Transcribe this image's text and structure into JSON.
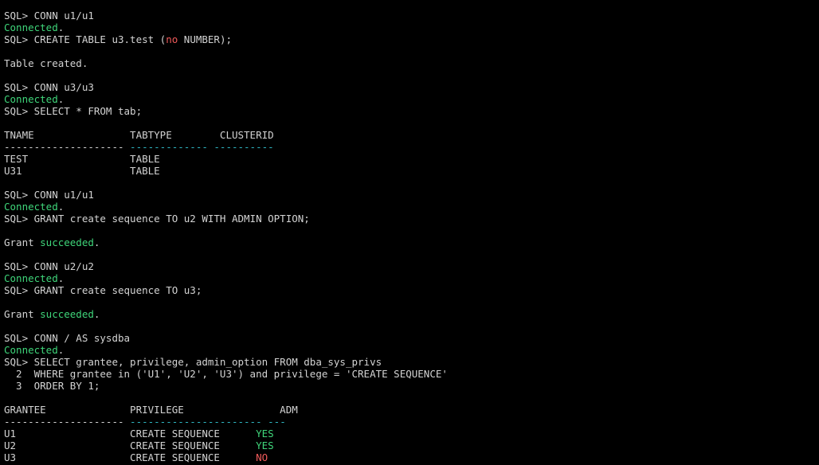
{
  "colors": {
    "background": "#000000",
    "text": "#d3d3d3",
    "green": "#3fd67a",
    "red": "#f05a5a",
    "teal": "#2fb6c2"
  },
  "terminal": {
    "lines": [
      {
        "segs": [
          {
            "t": "SQL> CONN u1/u1"
          }
        ]
      },
      {
        "segs": [
          {
            "t": "Connected",
            "c": "green"
          },
          {
            "t": "."
          }
        ]
      },
      {
        "segs": [
          {
            "t": "SQL> CREATE TABLE u3.test ("
          },
          {
            "t": "no",
            "c": "red"
          },
          {
            "t": " NUMBER);"
          }
        ]
      },
      {
        "segs": []
      },
      {
        "segs": [
          {
            "t": "Table created."
          }
        ]
      },
      {
        "segs": []
      },
      {
        "segs": [
          {
            "t": "SQL> CONN u3/u3"
          }
        ]
      },
      {
        "segs": [
          {
            "t": "Connected",
            "c": "green"
          },
          {
            "t": "."
          }
        ]
      },
      {
        "segs": [
          {
            "t": "SQL> SELECT * FROM tab;"
          }
        ]
      },
      {
        "segs": []
      },
      {
        "segs": [
          {
            "t": "TNAME                TABTYPE        CLUSTERID"
          }
        ]
      },
      {
        "segs": [
          {
            "t": "-------------------- "
          },
          {
            "t": "------------- ----------",
            "c": "teal"
          }
        ]
      },
      {
        "segs": [
          {
            "t": "TEST                 TABLE"
          }
        ]
      },
      {
        "segs": [
          {
            "t": "U31                  TABLE"
          }
        ]
      },
      {
        "segs": []
      },
      {
        "segs": [
          {
            "t": "SQL> CONN u1/u1"
          }
        ]
      },
      {
        "segs": [
          {
            "t": "Connected",
            "c": "green"
          },
          {
            "t": "."
          }
        ]
      },
      {
        "segs": [
          {
            "t": "SQL> GRANT create sequence TO u2 WITH ADMIN OPTION;"
          }
        ]
      },
      {
        "segs": []
      },
      {
        "segs": [
          {
            "t": "Grant "
          },
          {
            "t": "succeeded",
            "c": "green"
          },
          {
            "t": "."
          }
        ]
      },
      {
        "segs": []
      },
      {
        "segs": [
          {
            "t": "SQL> CONN u2/u2"
          }
        ]
      },
      {
        "segs": [
          {
            "t": "Connected",
            "c": "green"
          },
          {
            "t": "."
          }
        ]
      },
      {
        "segs": [
          {
            "t": "SQL> GRANT create sequence TO u3;"
          }
        ]
      },
      {
        "segs": []
      },
      {
        "segs": [
          {
            "t": "Grant "
          },
          {
            "t": "succeeded",
            "c": "green"
          },
          {
            "t": "."
          }
        ]
      },
      {
        "segs": []
      },
      {
        "segs": [
          {
            "t": "SQL> CONN / AS sysdba"
          }
        ]
      },
      {
        "segs": [
          {
            "t": "Connected",
            "c": "green"
          },
          {
            "t": "."
          }
        ]
      },
      {
        "segs": [
          {
            "t": "SQL> SELECT grantee, privilege, admin_option FROM dba_sys_privs"
          }
        ]
      },
      {
        "segs": [
          {
            "t": "  2  WHERE grantee in ('U1', 'U2', 'U3') and privilege = 'CREATE SEQUENCE'"
          }
        ]
      },
      {
        "segs": [
          {
            "t": "  3  ORDER BY 1;"
          }
        ]
      },
      {
        "segs": []
      },
      {
        "segs": [
          {
            "t": "GRANTEE              PRIVILEGE                ADM"
          }
        ]
      },
      {
        "segs": [
          {
            "t": "-------------------- "
          },
          {
            "t": "---------------------- ---",
            "c": "teal"
          }
        ]
      },
      {
        "segs": [
          {
            "t": "U1                   CREATE SEQUENCE      "
          },
          {
            "t": "YES",
            "c": "green"
          }
        ]
      },
      {
        "segs": [
          {
            "t": "U2                   CREATE SEQUENCE      "
          },
          {
            "t": "YES",
            "c": "green"
          }
        ]
      },
      {
        "segs": [
          {
            "t": "U3                   CREATE SEQUENCE      "
          },
          {
            "t": "NO",
            "c": "red"
          }
        ]
      }
    ]
  }
}
